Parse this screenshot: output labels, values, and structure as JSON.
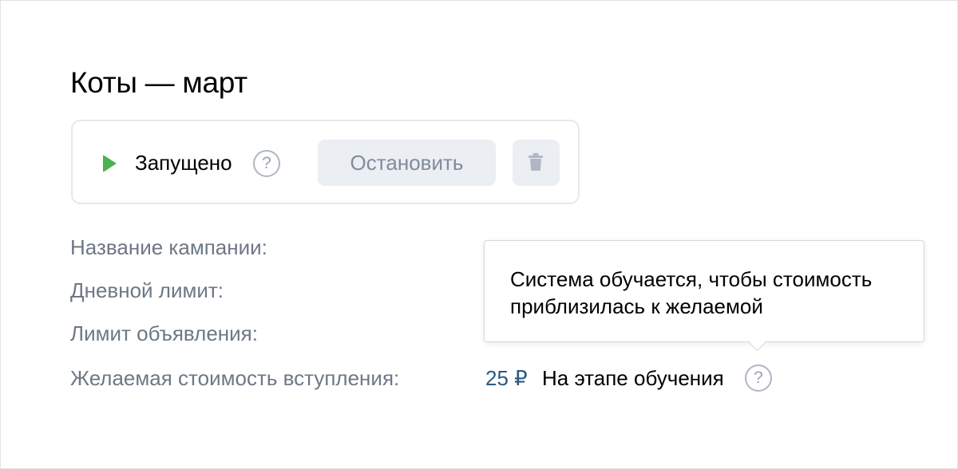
{
  "page_title": "Коты — март",
  "status_card": {
    "status_label": "Запущено",
    "status_help": "?",
    "stop_button_label": "Остановить",
    "status_icon": "play-icon",
    "delete_icon": "trash-icon",
    "status_color": "#4bb34b"
  },
  "fields": [
    {
      "label": "Название кампании:"
    },
    {
      "label": "Дневной лимит:"
    },
    {
      "label": "Лимит объявления:"
    },
    {
      "label": "Желаемая стоимость вступления:"
    }
  ],
  "desired_cost": {
    "value": "25 ₽",
    "status": "На этапе обучения",
    "help": "?"
  },
  "tooltip": {
    "text": "Система обучается, чтобы стоимость приблизилась к желаемой"
  }
}
